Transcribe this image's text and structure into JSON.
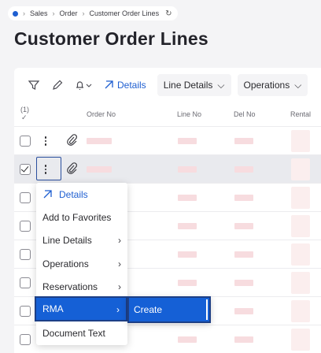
{
  "breadcrumb": {
    "items": [
      "Sales",
      "Order",
      "Customer Order Lines"
    ],
    "refresh_icon": "refresh-icon"
  },
  "page": {
    "title": "Customer Order Lines"
  },
  "toolbar": {
    "details_label": "Details",
    "line_details_label": "Line Details",
    "operations_label": "Operations"
  },
  "table": {
    "selection_count": "(1)",
    "columns": [
      "Order No",
      "Line No",
      "Del No",
      "Rental"
    ]
  },
  "context_menu": {
    "items": [
      "Details",
      "Add to Favorites",
      "Line Details",
      "Operations",
      "Reservations",
      "RMA",
      "Document Text"
    ],
    "active_item": "RMA"
  },
  "submenu": {
    "items": [
      "Create"
    ]
  },
  "colors": {
    "accent": "#1560d6",
    "link": "#1f5fd1",
    "placeholder": "#f7dcdf"
  }
}
